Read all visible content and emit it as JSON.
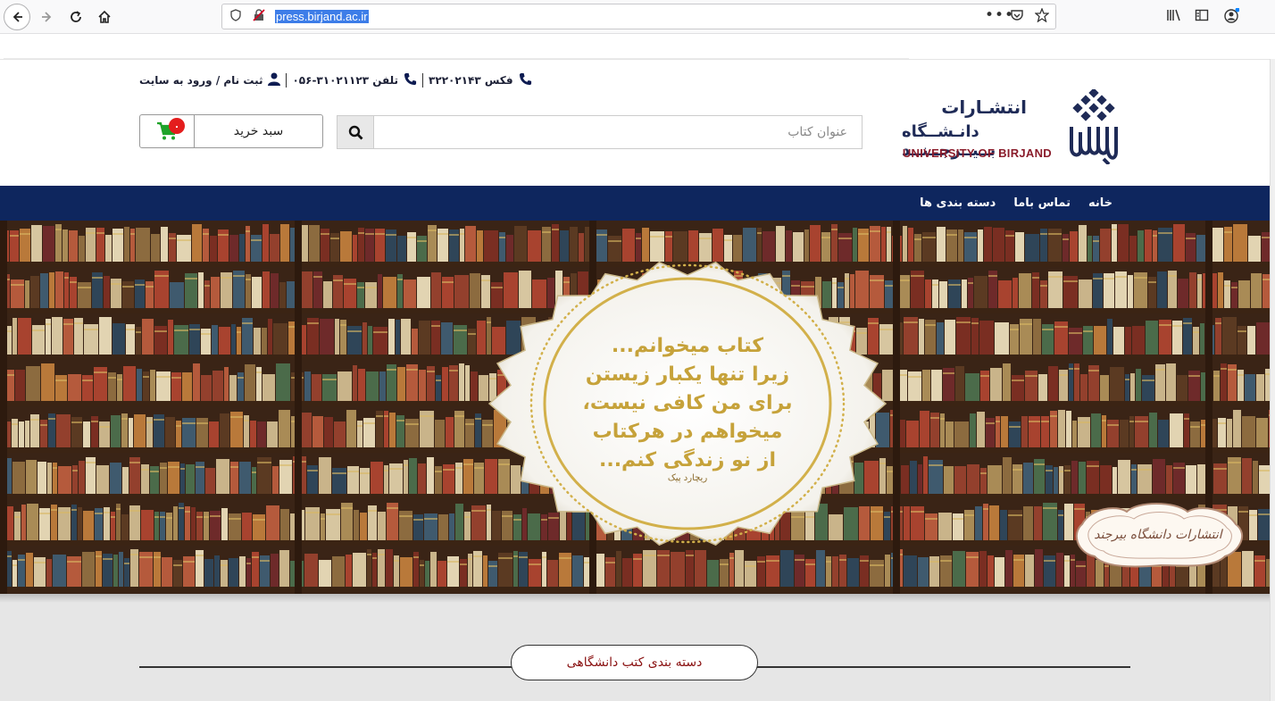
{
  "browser": {
    "url": "press.birjand.ac.ir",
    "nav_icons": [
      "back-arrow-icon",
      "forward-arrow-icon",
      "reload-icon",
      "home-icon"
    ],
    "url_icons": [
      "info-icon",
      "insecure-lock-icon",
      "more-icon",
      "pocket-icon",
      "star-icon"
    ],
    "toolbar_icons": [
      "library-icon",
      "sidebar-icon",
      "account-icon"
    ]
  },
  "topbar": {
    "fax": "فکس ۳۲۲۰۲۱۴۳",
    "phone": "۰۵۶-۳۱۰۲۱۱۲۳ تلفن",
    "account": "ثبت نام / ورود به سایت"
  },
  "logo": {
    "line1": "انتشـارات",
    "line2": "دانـشــگاه بــیــرجــنــد",
    "line3": "UNIVERSITY OF BIRJAND"
  },
  "search": {
    "placeholder": "عنوان کتاب"
  },
  "cart": {
    "label": "سبد خرید",
    "count": "۰"
  },
  "nav": {
    "items": [
      "خانه",
      "تماس باما",
      "دسته بندی ها"
    ]
  },
  "banner": {
    "quote": [
      "کتاب میخوانم...",
      "زیرا تنها یکبار زیستن",
      "برای من کافی نیست،",
      "میخواهم در هرکتاب",
      "از نو زندگی کنم..."
    ],
    "author": "ریچارد پیک",
    "stamp": "انتشارات دانشگاه بیرجند"
  },
  "section": {
    "title": "دسته بندی کتب دانشگاهی"
  },
  "colors": {
    "navy": "#0e265e",
    "gold": "#c6a23a",
    "maroon": "#8a1c2b",
    "cart_green": "#1fa32a",
    "badge_red": "#e41d1d"
  }
}
